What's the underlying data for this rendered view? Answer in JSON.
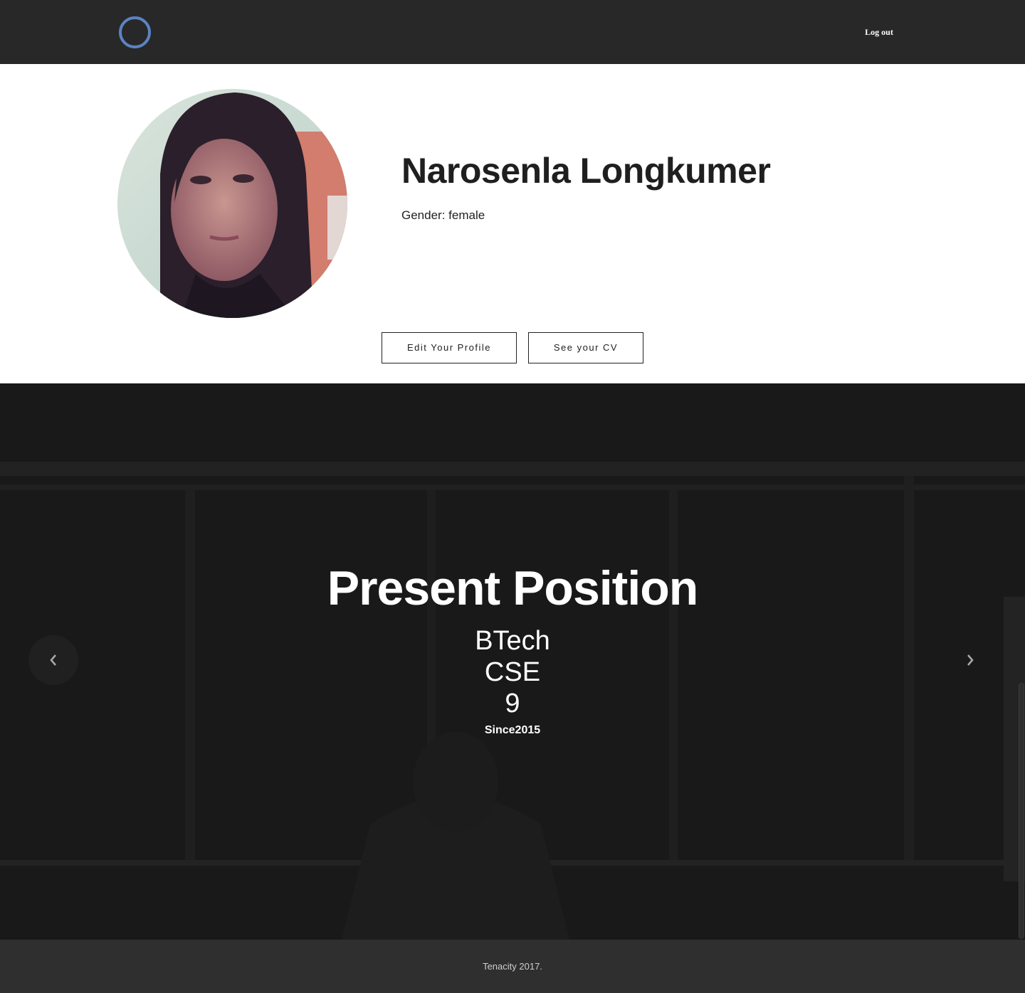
{
  "nav": {
    "logo_icon": "ring-logo-icon",
    "logout_label": "Log out"
  },
  "profile": {
    "name": "Narosenla Longkumer",
    "gender_label": "Gender: ",
    "gender_value": "female",
    "edit_button_label": "Edit Your Profile",
    "cv_button_label": "See your CV"
  },
  "position": {
    "heading": "Present Position",
    "degree": "BTech",
    "branch": "CSE",
    "semester": "9",
    "since": "Since2015",
    "prev_icon": "chevron-left-icon",
    "next_icon": "chevron-right-icon"
  },
  "footer": {
    "text": "Tenacity 2017."
  },
  "colors": {
    "topbar": "#282828",
    "logo_ring": "#5b83c3",
    "hero_bg": "#1a1a1a",
    "footer": "#2f2f2f"
  }
}
